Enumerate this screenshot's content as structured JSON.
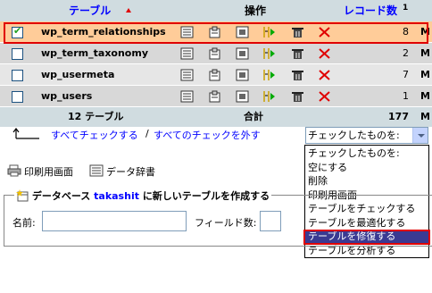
{
  "header": {
    "col_table": "テーブル",
    "col_table_sort_icon": "sort-up-icon",
    "col_ops": "操作",
    "col_records": "レコード数",
    "col_records_note": "1"
  },
  "rows": [
    {
      "name": "wp_term_relationships",
      "records": "8",
      "tail": "M",
      "checked": true
    },
    {
      "name": "wp_term_taxonomy",
      "records": "2",
      "tail": "M",
      "checked": false
    },
    {
      "name": "wp_usermeta",
      "records": "7",
      "tail": "M",
      "checked": false
    },
    {
      "name": "wp_users",
      "records": "1",
      "tail": "M",
      "checked": false
    }
  ],
  "total": {
    "tables": "12 テーブル",
    "label": "合計",
    "records": "177",
    "tail": "M"
  },
  "check_all": "すべてチェックする",
  "separator": "/",
  "uncheck_all": "すべてのチェックを外す",
  "dropdown": {
    "selected": "チェックしたものを:",
    "options": [
      "チェックしたものを:",
      "空にする",
      "削除",
      "印刷用画面",
      "テーブルをチェックする",
      "テーブルを最適化する",
      "テーブルを修復する",
      "テーブルを分析する"
    ],
    "highlighted_index": 6
  },
  "print_view": "印刷用画面",
  "data_dict": "データ辞書",
  "create_table": {
    "prefix": "データベース",
    "db_name": "takashit",
    "suffix": "に新しいテーブルを作成する",
    "name_label": "名前:",
    "fields_label": "フィールド数:"
  },
  "colors": {
    "header_bg": "#d0dce0",
    "selected_row": "#ffcc99",
    "highlight_outline": "#e00000",
    "link": "#0000ff",
    "dropdown_highlight": "#3a3a92"
  }
}
